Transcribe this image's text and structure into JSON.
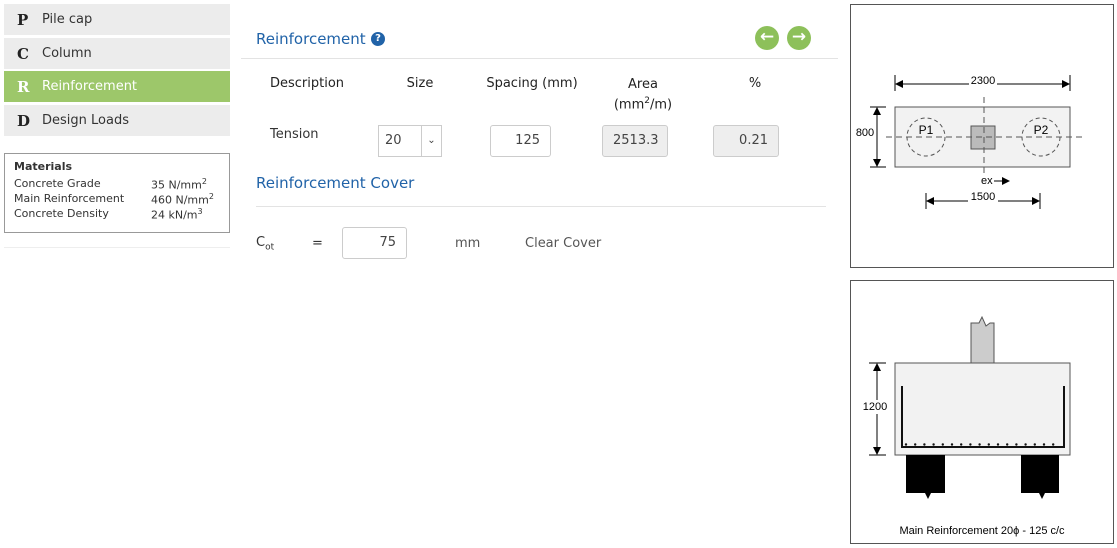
{
  "sidebar": {
    "items": [
      {
        "letter": "P",
        "label": "Pile cap"
      },
      {
        "letter": "C",
        "label": "Column"
      },
      {
        "letter": "R",
        "label": "Reinforcement",
        "active": true
      },
      {
        "letter": "D",
        "label": "Design Loads"
      }
    ]
  },
  "materials": {
    "title": "Materials",
    "rows": [
      {
        "label": "Concrete Grade",
        "value": "35 N/mm",
        "sup": "2"
      },
      {
        "label": "Main Reinforcement",
        "value": "460 N/mm",
        "sup": "2"
      },
      {
        "label": "Concrete Density",
        "value": "24 kN/m",
        "sup": "3"
      }
    ]
  },
  "main": {
    "title": "Reinforcement",
    "help_icon": "question-circle-icon",
    "prev_icon": "arrow-left-circle-icon",
    "next_icon": "arrow-right-circle-icon",
    "headers": {
      "description": "Description",
      "size": "Size",
      "spacing": "Spacing (mm)",
      "area_line1": "Area",
      "area_line2a": "(mm",
      "area_sup": "2",
      "area_line2b": "/m)",
      "percent": "%"
    },
    "row": {
      "description": "Tension",
      "size": "20",
      "spacing": "125",
      "area": "2513.3",
      "percent": "0.21"
    },
    "cover_title": "Reinforcement Cover",
    "cover": {
      "symbol": "C",
      "subscript": "ot",
      "equals": "=",
      "value": "75",
      "unit": "mm",
      "description": "Clear Cover"
    }
  },
  "plan": {
    "width_dim": "2300",
    "depth_dim": "800",
    "pile_spacing_dim": "1500",
    "pile1": "P1",
    "pile2": "P2",
    "ecc_label": "ex"
  },
  "section": {
    "height_dim": "1200",
    "caption": "Main Reinforcement 20ϕ - 125 c/c"
  },
  "colors": {
    "accent": "#2163a8",
    "active_nav": "#9dc76a",
    "nav_button": "#8dc05a"
  }
}
